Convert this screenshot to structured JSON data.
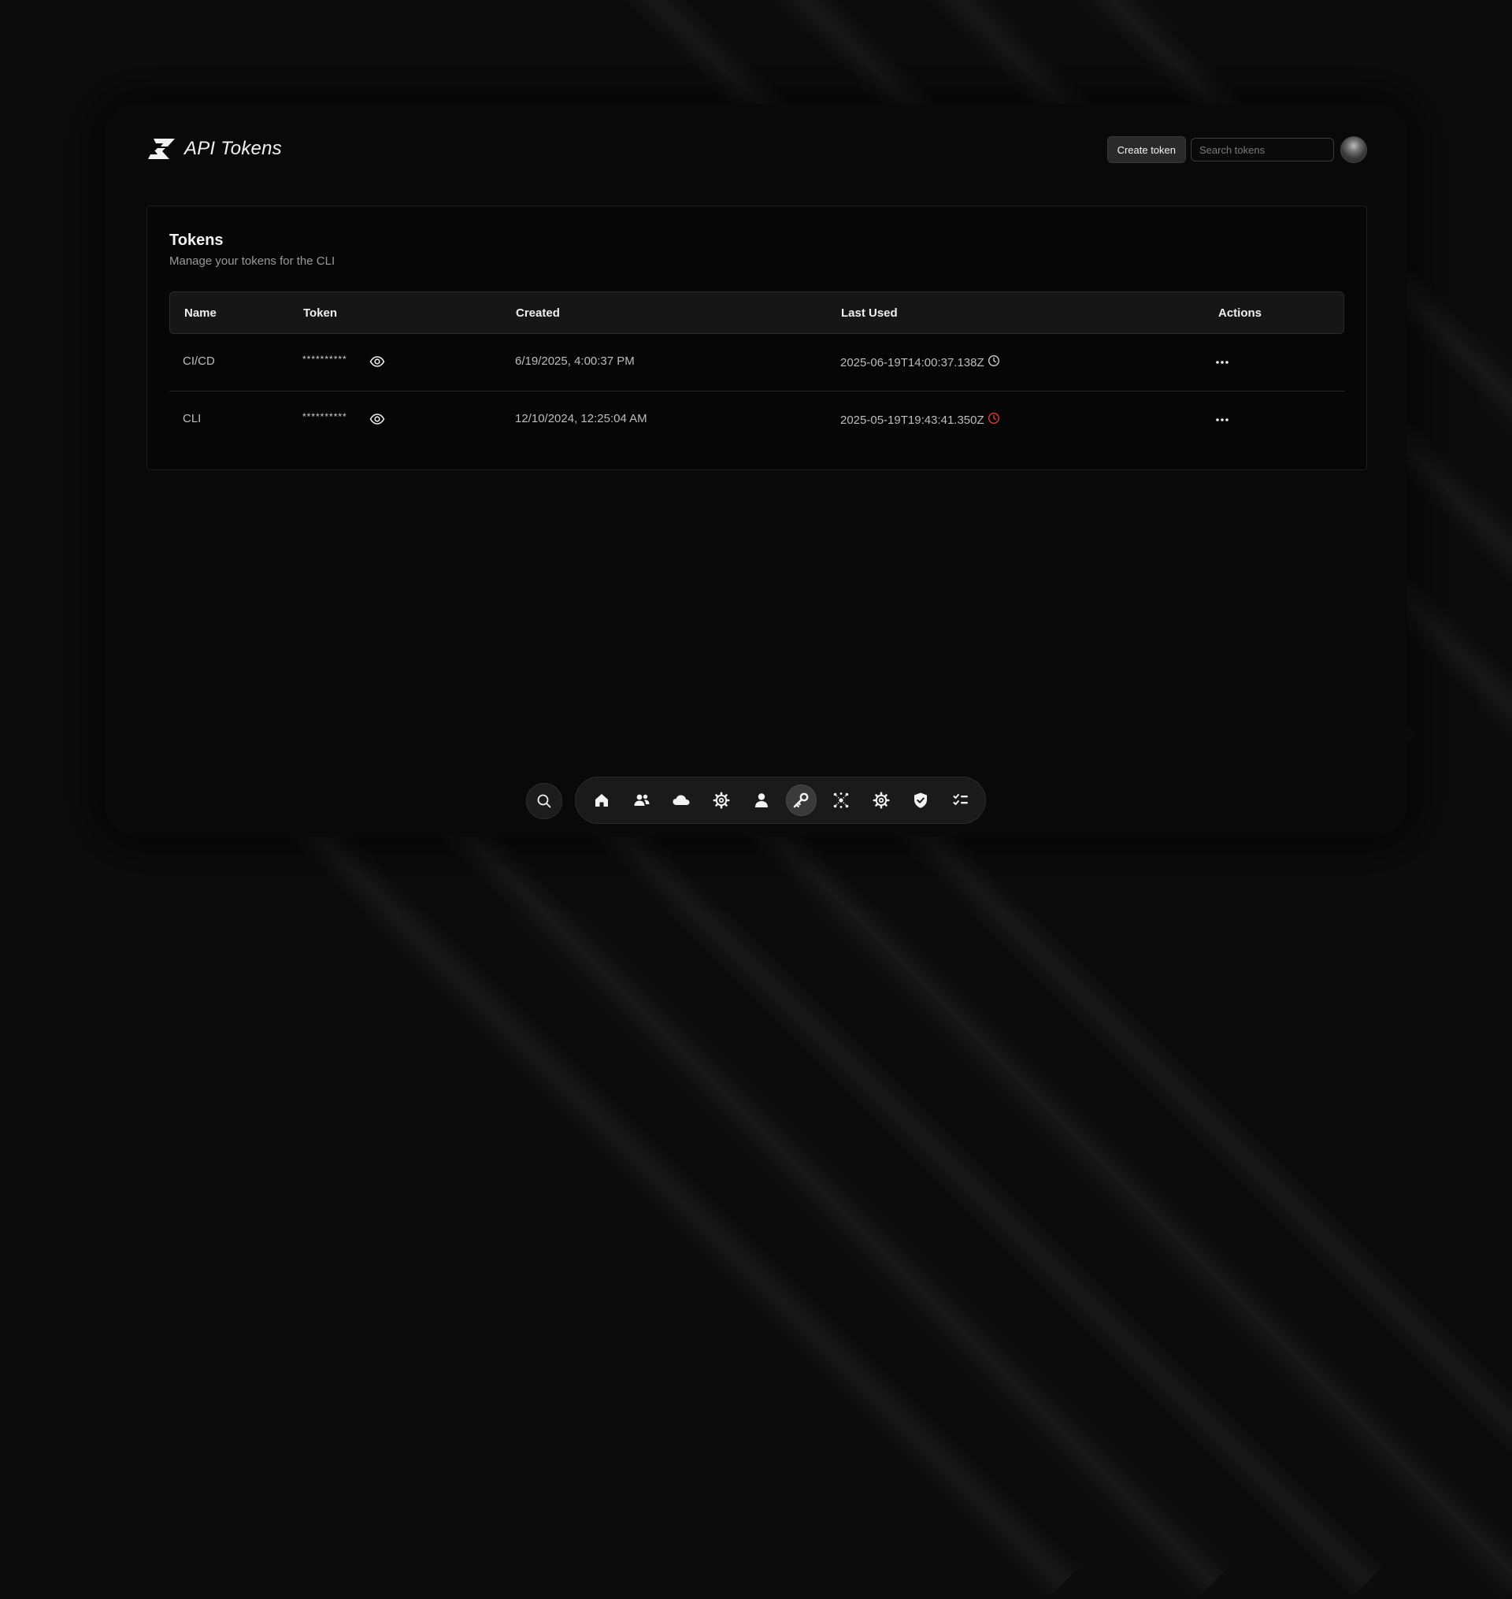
{
  "app": {
    "title": "API Tokens"
  },
  "header": {
    "create_label": "Create token",
    "search_placeholder": "Search tokens"
  },
  "card": {
    "title": "Tokens",
    "subtitle": "Manage your tokens for the CLI"
  },
  "table": {
    "columns": [
      "Name",
      "Token",
      "Created",
      "Last Used",
      "Actions"
    ],
    "rows": [
      {
        "name": "CI/CD",
        "token": "**********",
        "created": "6/19/2025, 4:00:37 PM",
        "last_used": "2025-06-19T14:00:37.138Z",
        "status_color": "#cfcfcf"
      },
      {
        "name": "CLI",
        "token": "**********",
        "created": "12/10/2024, 12:25:04 AM",
        "last_used": "2025-05-19T19:43:41.350Z",
        "status_color": "#e53935"
      }
    ]
  },
  "dock": {
    "items": [
      "home-icon",
      "users-icon",
      "cloud-icon",
      "settings-icon",
      "user-icon",
      "key-icon",
      "network-icon",
      "gear-icon",
      "shield-check-icon",
      "checklist-icon"
    ],
    "active": "key-icon"
  },
  "colors": {
    "background": "#0c0c0c",
    "surface": "#060606",
    "danger": "#e53935"
  }
}
